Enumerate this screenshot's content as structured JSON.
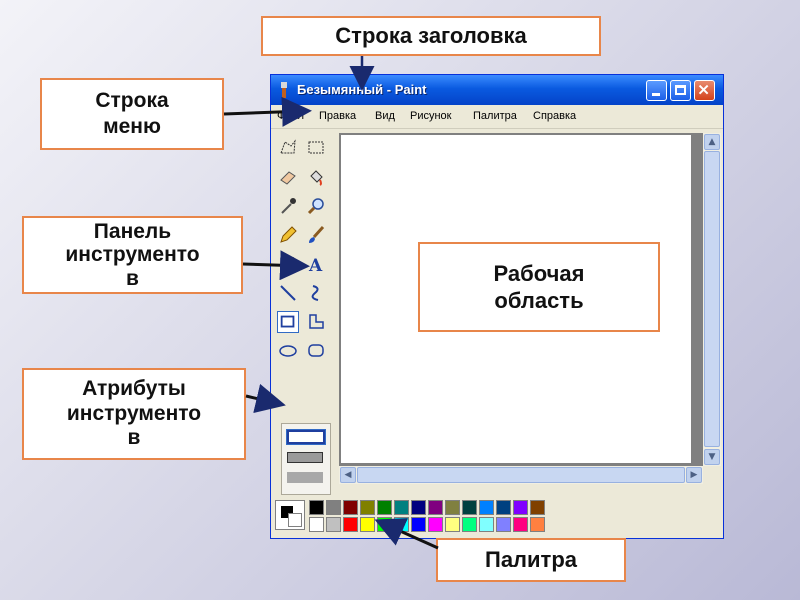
{
  "labels": {
    "title_bar": "Строка заголовка",
    "menu_bar": [
      "Строка",
      "меню"
    ],
    "toolbox": [
      "Панель",
      "инструменто",
      "в"
    ],
    "workspace": [
      "Рабочая",
      "область"
    ],
    "attributes": [
      "Атрибуты",
      "инструменто",
      "в"
    ],
    "palette": "Палитра"
  },
  "window": {
    "title": "Безымянный - Paint",
    "menu": [
      "Файл",
      "Правка",
      "Вид",
      "Рисунок",
      "Палитра",
      "Справка"
    ]
  },
  "tools": [
    "free-form-select-icon",
    "rect-select-icon",
    "eraser-icon",
    "fill-icon",
    "color-picker-icon",
    "magnifier-icon",
    "pencil-icon",
    "brush-icon",
    "airbrush-icon",
    "text-icon",
    "line-icon",
    "curve-icon",
    "rectangle-icon",
    "polygon-icon",
    "ellipse-icon",
    "rounded-rect-icon"
  ],
  "palette_colors": {
    "top": [
      "#000000",
      "#808080",
      "#800000",
      "#808000",
      "#008000",
      "#008080",
      "#000080",
      "#800080",
      "#808040",
      "#004040",
      "#0080ff",
      "#004080",
      "#8000ff",
      "#804000"
    ],
    "bottom": [
      "#ffffff",
      "#c0c0c0",
      "#ff0000",
      "#ffff00",
      "#00ff00",
      "#00ffff",
      "#0000ff",
      "#ff00ff",
      "#ffff80",
      "#00ff80",
      "#80ffff",
      "#8080ff",
      "#ff0080",
      "#ff8040"
    ]
  },
  "accent": {
    "callout_border": "#e8864a",
    "titlebar": "#0a5ae0"
  }
}
